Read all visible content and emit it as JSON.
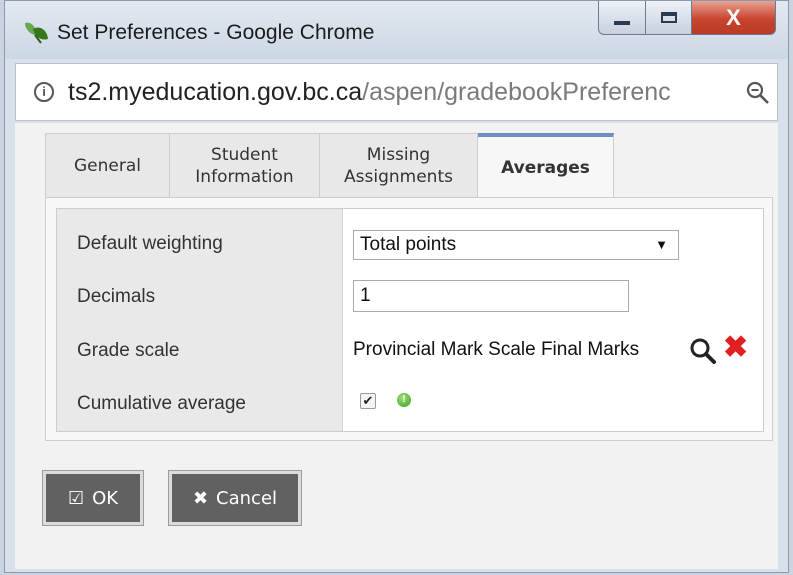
{
  "window": {
    "title": "Set Preferences - Google Chrome",
    "controls": {
      "minimize": "minimize",
      "maximize": "maximize",
      "close": "X"
    }
  },
  "address": {
    "host": "ts2.myeducation.gov.bc.ca",
    "path": "/aspen/gradebookPreferenc"
  },
  "tabs": [
    {
      "label": "General",
      "active": false
    },
    {
      "label": "Student Information",
      "active": false
    },
    {
      "label": "Missing Assignments",
      "active": false
    },
    {
      "label": "Averages",
      "active": true
    }
  ],
  "form": {
    "default_weighting": {
      "label": "Default weighting",
      "value": "Total points"
    },
    "decimals": {
      "label": "Decimals",
      "value": "1"
    },
    "grade_scale": {
      "label": "Grade scale",
      "value": "Provincial Mark Scale Final Marks"
    },
    "cumulative_average": {
      "label": "Cumulative average",
      "checked": true
    }
  },
  "buttons": {
    "ok": "OK",
    "cancel": "Cancel"
  },
  "colors": {
    "active_tab_accent": "#6d8fc6",
    "clear_icon": "#e02020",
    "info_dot": "#37a11c",
    "button_bg": "#616161"
  }
}
